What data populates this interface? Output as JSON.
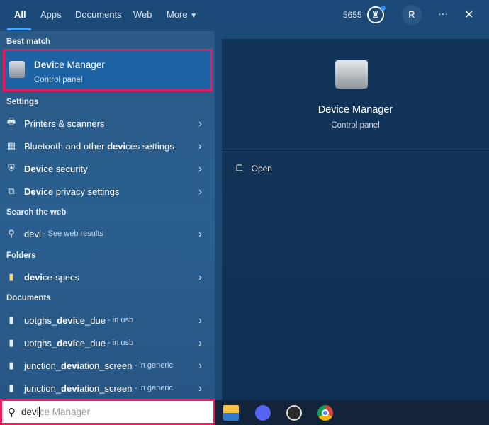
{
  "tabs": [
    "All",
    "Apps",
    "Documents",
    "Web",
    "More"
  ],
  "header": {
    "points": "5655",
    "avatar": "R",
    "more": "···",
    "close": "✕"
  },
  "best_match": {
    "header": "Best match",
    "title_match": "Devi",
    "title_rest": "ce Manager",
    "subtitle": "Control panel"
  },
  "settings": {
    "header": "Settings",
    "items": [
      {
        "pre": "",
        "match": "",
        "post": "Printers & scanners"
      },
      {
        "pre": "Bluetooth and other ",
        "match": "devi",
        "post": "ces settings"
      },
      {
        "pre": "",
        "match": "Devi",
        "post": "ce security"
      },
      {
        "pre": "",
        "match": "Devi",
        "post": "ce privacy settings"
      }
    ]
  },
  "web": {
    "header": "Search the web",
    "query": "devi",
    "hint": " - See web results"
  },
  "folders": {
    "header": "Folders",
    "items": [
      {
        "match": "devi",
        "post": "ce-specs"
      }
    ]
  },
  "documents": {
    "header": "Documents",
    "items": [
      {
        "pre": "uotghs_",
        "match": "devi",
        "post": "ce_due",
        "hint": " - in usb"
      },
      {
        "pre": "uotghs_",
        "match": "devi",
        "post": "ce_due",
        "hint": " - in usb"
      },
      {
        "pre": "junction_",
        "match": "devi",
        "post": "ation_screen",
        "hint": " - in generic"
      },
      {
        "pre": "junction_",
        "match": "devi",
        "post": "ation_screen",
        "hint": " - in generic"
      }
    ]
  },
  "preview": {
    "title": "Device Manager",
    "subtitle": "Control panel",
    "action": "Open"
  },
  "search": {
    "typed": "devi",
    "suggestion": "ce Manager"
  }
}
